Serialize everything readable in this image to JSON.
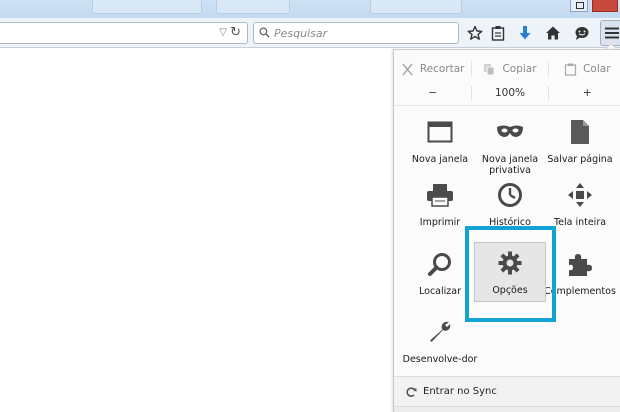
{
  "toolbar": {
    "search_placeholder": "Pesquisar"
  },
  "menu": {
    "edit": {
      "cut": "Recortar",
      "copy": "Copiar",
      "paste": "Colar"
    },
    "zoom": {
      "minus": "−",
      "value": "100%",
      "plus": "+"
    },
    "items": [
      {
        "label": "Nova janela",
        "icon": "window-icon"
      },
      {
        "label": "Nova janela privativa",
        "icon": "mask-icon"
      },
      {
        "label": "Salvar página",
        "icon": "page-icon"
      },
      {
        "label": "Imprimir",
        "icon": "printer-icon"
      },
      {
        "label": "Histórico",
        "icon": "clock-icon"
      },
      {
        "label": "Tela inteira",
        "icon": "fullscreen-arrows-icon"
      },
      {
        "label": "Localizar",
        "icon": "magnifier-icon"
      },
      {
        "label": "Opções",
        "icon": "gear-icon"
      },
      {
        "label": "Complementos",
        "icon": "puzzle-icon"
      },
      {
        "label": "Desenvolve-dor",
        "icon": "wrench-icon"
      }
    ],
    "sync_label": "Entrar no Sync"
  },
  "colors": {
    "highlight": "#12a2d3",
    "icon": "#4a4a4a",
    "download_arrow": "#2a7fd4"
  }
}
